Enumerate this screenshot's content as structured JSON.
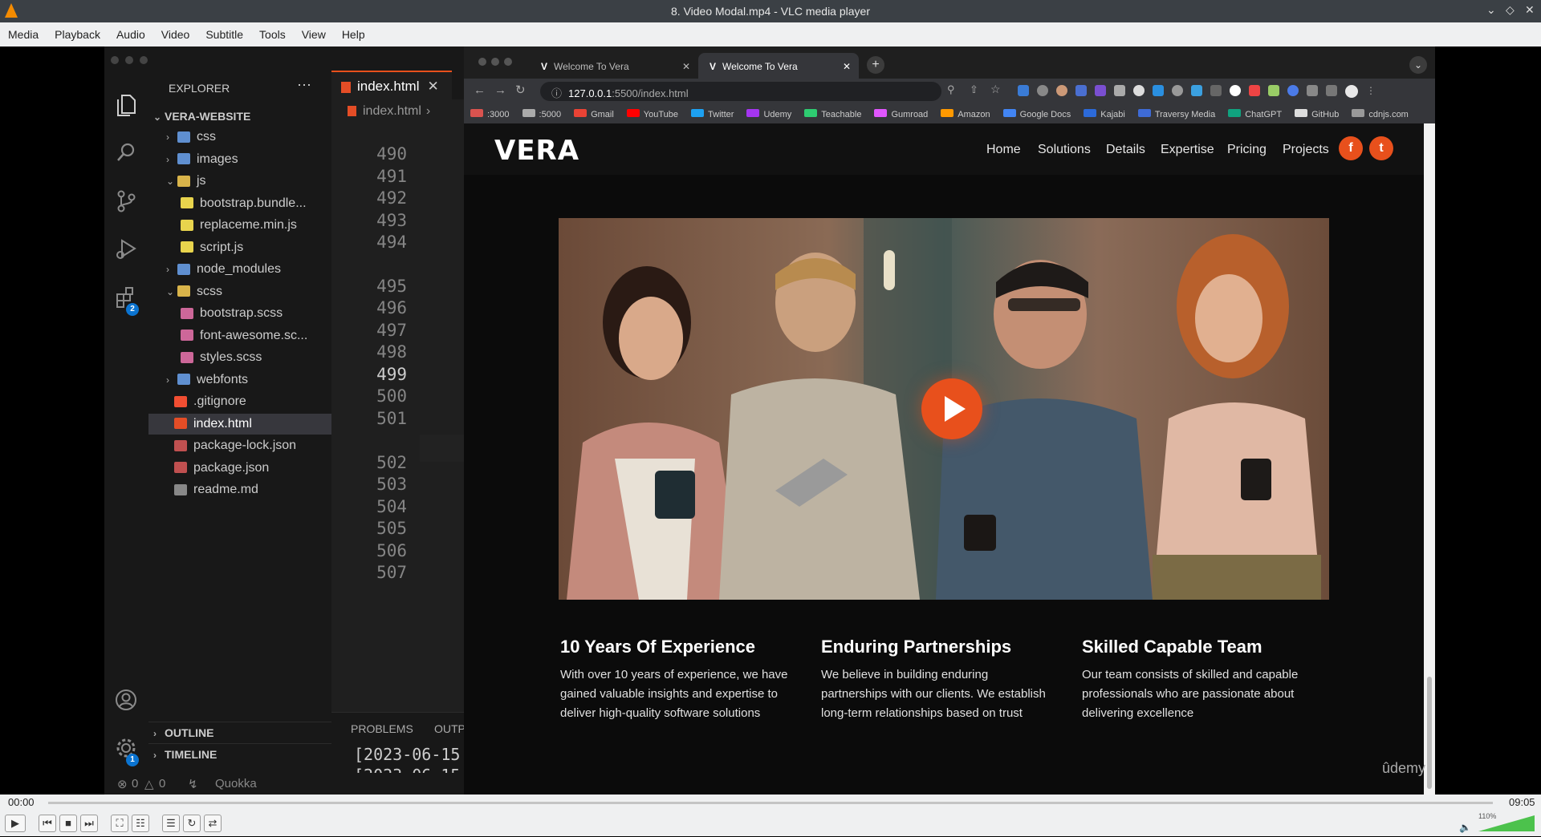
{
  "window": {
    "title": "8. Video Modal.mp4 - VLC media player"
  },
  "menu": [
    "Media",
    "Playback",
    "Audio",
    "Video",
    "Subtitle",
    "Tools",
    "View",
    "Help"
  ],
  "vscode": {
    "explorer_title": "EXPLORER",
    "project": "VERA-WEBSITE",
    "tree": [
      {
        "label": "css",
        "type": "folder"
      },
      {
        "label": "images",
        "type": "folder"
      },
      {
        "label": "js",
        "type": "folder-open"
      },
      {
        "label": "bootstrap.bundle...",
        "type": "js"
      },
      {
        "label": "replaceme.min.js",
        "type": "js"
      },
      {
        "label": "script.js",
        "type": "js"
      },
      {
        "label": "node_modules",
        "type": "folder"
      },
      {
        "label": "scss",
        "type": "folder-open"
      },
      {
        "label": "bootstrap.scss",
        "type": "scss"
      },
      {
        "label": "font-awesome.sc...",
        "type": "scss"
      },
      {
        "label": "styles.scss",
        "type": "scss"
      },
      {
        "label": "webfonts",
        "type": "folder"
      },
      {
        "label": ".gitignore",
        "type": "git"
      },
      {
        "label": "index.html",
        "type": "html"
      },
      {
        "label": "package-lock.json",
        "type": "json"
      },
      {
        "label": "package.json",
        "type": "json"
      },
      {
        "label": "readme.md",
        "type": "md"
      }
    ],
    "tab": "index.html",
    "breadcrumb": "index.html",
    "line_numbers": [
      "490",
      "491",
      "492",
      "493",
      "494",
      "495",
      "496",
      "497",
      "498",
      "499",
      "500",
      "501",
      "502",
      "503",
      "504",
      "505",
      "506",
      "507"
    ],
    "panel_tabs": [
      "PROBLEMS",
      "OUTP"
    ],
    "terminal_lines": [
      "[2023-06-15",
      "[2023-06-15"
    ],
    "outline": "OUTLINE",
    "timeline": "TIMELINE",
    "status": {
      "errors": "0",
      "warnings": "0",
      "quokka": "Quokka"
    },
    "badges": {
      "extensions": "2",
      "settings": "1"
    }
  },
  "browser": {
    "tabs": [
      "Welcome To Vera",
      "Welcome To Vera"
    ],
    "url_host": "127.0.0.1",
    "url_path": ":5500/index.html",
    "bookmarks": [
      ":3000",
      ":5000",
      "Gmail",
      "YouTube",
      "Twitter",
      "Udemy",
      "Teachable",
      "Gumroad",
      "Amazon",
      "Google Docs",
      "Kajabi",
      "Traversy Media",
      "ChatGPT",
      "GitHub",
      "cdnjs.com"
    ]
  },
  "site": {
    "logo": "VERA",
    "nav": [
      "Home",
      "Solutions",
      "Details",
      "Expertise",
      "Pricing",
      "Projects"
    ],
    "social": [
      "f",
      "t"
    ],
    "features": [
      {
        "title": "10 Years Of Experience",
        "text": "With over 10 years of experience, we have gained valuable insights and expertise to deliver high-quality software solutions"
      },
      {
        "title": "Enduring Partnerships",
        "text": "We believe in building enduring partnerships with our clients. We establish long-term relationships based on trust"
      },
      {
        "title": "Skilled Capable Team",
        "text": "Our team consists of skilled and capable professionals who are passionate about delivering excellence"
      }
    ],
    "watermark": "ûdemy"
  },
  "player": {
    "time_elapsed": "00:00",
    "time_total": "09:05",
    "volume": "110%",
    "progress": 0.0
  },
  "colors": {
    "accent": "#e8501c",
    "vlc_orange": "#f48b00"
  }
}
